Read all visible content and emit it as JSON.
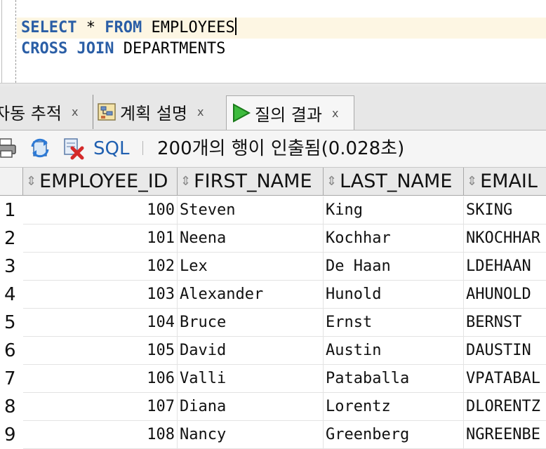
{
  "editor": {
    "line1": {
      "kw1": "SELECT",
      "star": " * ",
      "kw2": "FROM",
      "rest": " EMPLOYEES"
    },
    "line2": {
      "kw1": "CROSS",
      "kw2": "JOIN",
      "rest": " DEPARTMENTS"
    }
  },
  "tabs": [
    {
      "label": "자동 추적",
      "close": "x",
      "icon": ""
    },
    {
      "label": "계획 설명",
      "close": "x",
      "icon": "explain-plan-icon"
    },
    {
      "label": "질의 결과",
      "close": "x",
      "icon": "run-icon",
      "active": true
    }
  ],
  "toolbar": {
    "icons": [
      "print-icon",
      "refresh-icon",
      "cancel-icon"
    ],
    "sql_label": "SQL",
    "status": "200개의 행이 인출됨(0.028초)"
  },
  "grid": {
    "columns": [
      "EMPLOYEE_ID",
      "FIRST_NAME",
      "LAST_NAME",
      "EMAIL"
    ],
    "rows": [
      {
        "n": "1",
        "id": "100",
        "first": "Steven",
        "last": "King",
        "email": "SKING"
      },
      {
        "n": "2",
        "id": "101",
        "first": "Neena",
        "last": "Kochhar",
        "email": "NKOCHHAR"
      },
      {
        "n": "3",
        "id": "102",
        "first": "Lex",
        "last": "De Haan",
        "email": "LDEHAAN"
      },
      {
        "n": "4",
        "id": "103",
        "first": "Alexander",
        "last": "Hunold",
        "email": "AHUNOLD"
      },
      {
        "n": "5",
        "id": "104",
        "first": "Bruce",
        "last": "Ernst",
        "email": "BERNST"
      },
      {
        "n": "6",
        "id": "105",
        "first": "David",
        "last": "Austin",
        "email": "DAUSTIN"
      },
      {
        "n": "7",
        "id": "106",
        "first": "Valli",
        "last": "Pataballa",
        "email": "VPATABAL"
      },
      {
        "n": "8",
        "id": "107",
        "first": "Diana",
        "last": "Lorentz",
        "email": "DLORENTZ"
      },
      {
        "n": "9",
        "id": "108",
        "first": "Nancy",
        "last": "Greenberg",
        "email": "NGREENBE"
      }
    ]
  },
  "colors": {
    "keyword": "#2a5ea6",
    "current_line": "#fdf6e3",
    "sql_link": "#1f5fb0",
    "run_icon": "#27a527"
  }
}
